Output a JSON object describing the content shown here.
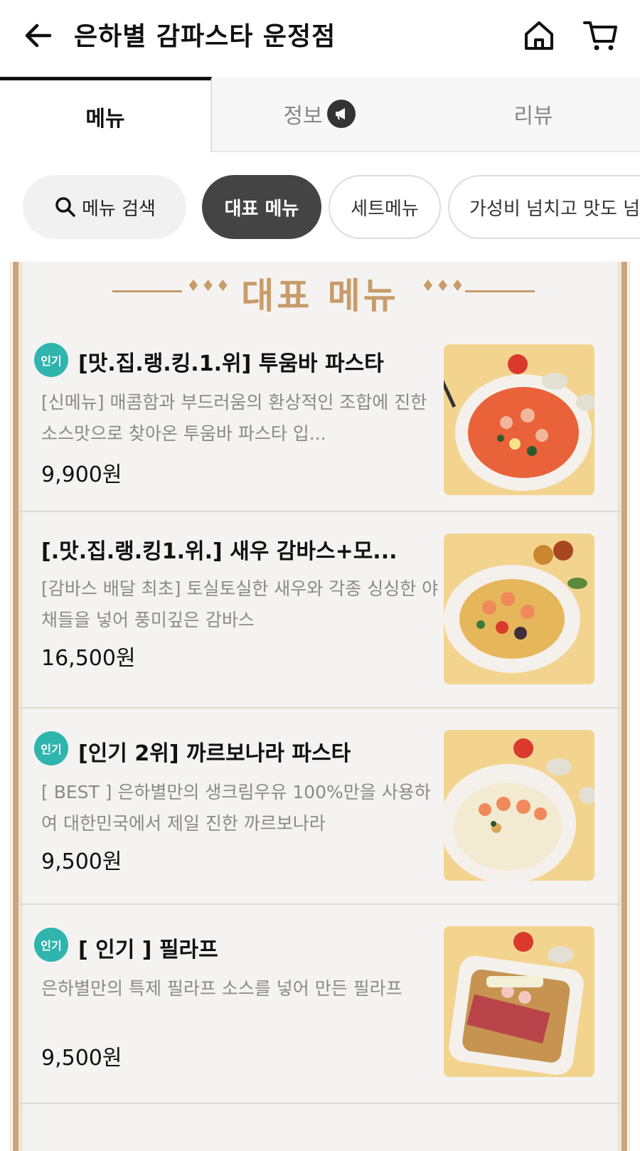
{
  "header": {
    "title": "은하별 감파스타 운정점",
    "back_icon": "arrow-left-icon",
    "home_icon": "home-icon",
    "cart_icon": "cart-icon"
  },
  "tabs": [
    {
      "label": "메뉴",
      "active": true
    },
    {
      "label": "정보",
      "active": false,
      "icon": "megaphone-icon"
    },
    {
      "label": "리뷰",
      "active": false
    }
  ],
  "chips": {
    "search_label": "메뉴 검색",
    "items": [
      "대표 메뉴",
      "세트메뉴",
      "가성비 넘치고 맛도 넘"
    ],
    "active_index": 0
  },
  "section": {
    "title": "대표 메뉴",
    "decor": "♦♦♦"
  },
  "menu_items": [
    {
      "badge": "인기",
      "name": "[맛.집.랭.킹.1.위] 투움바 파스타",
      "description": "[신메뉴] 매콤함과 부드러움의 환상적인 조합에 진한 소스맛으로 찾아온 투움바 파스타 입...",
      "price": "9,900원",
      "image": "tuumba-pasta-photo"
    },
    {
      "badge": "",
      "name": "[.맛.집.랭.킹1.위.] 새우 감바스+모...",
      "description": "[감바스 배달 최초] 토실토실한 새우와 각종 싱싱한 야채들을 넣어 풍미깊은 감바스",
      "price": "16,500원",
      "image": "gambas-photo"
    },
    {
      "badge": "인기",
      "name": "[인기 2위] 까르보나라 파스타",
      "description": "[ BEST ] 은하별만의 생크림우유 100%만을 사용하여 대한민국에서 제일 진한 까르보나라",
      "price": "9,500원",
      "image": "carbonara-photo"
    },
    {
      "badge": "인기",
      "name": "[ 인기 ] 필라프",
      "description": "은하별만의 특제 필라프 소스를 넣어 만든 필라프",
      "price": "9,500원",
      "image": "pilaf-photo"
    }
  ],
  "colors": {
    "accent_gold": "#c89b6a",
    "badge_teal": "#2fb5ad",
    "active_chip": "#444444"
  }
}
